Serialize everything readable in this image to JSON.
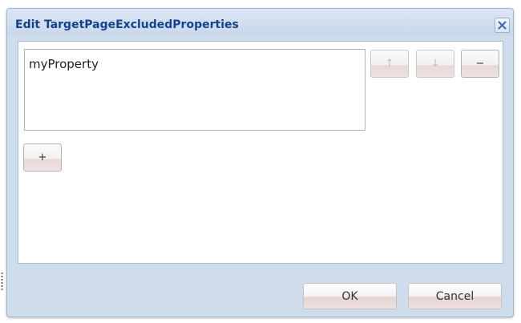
{
  "dialog": {
    "title": "Edit TargetPageExcludedProperties",
    "close_icon": "close-icon",
    "list": {
      "items": [
        "myProperty"
      ]
    },
    "buttons": {
      "move_up": "↑",
      "move_down": "↓",
      "remove": "−",
      "add": "+"
    },
    "footer": {
      "ok_label": "OK",
      "cancel_label": "Cancel"
    }
  },
  "colors": {
    "title": "#15428b",
    "frame": "#cfdcec",
    "frame_border": "#9db4d3",
    "panel": "#ffffff"
  }
}
